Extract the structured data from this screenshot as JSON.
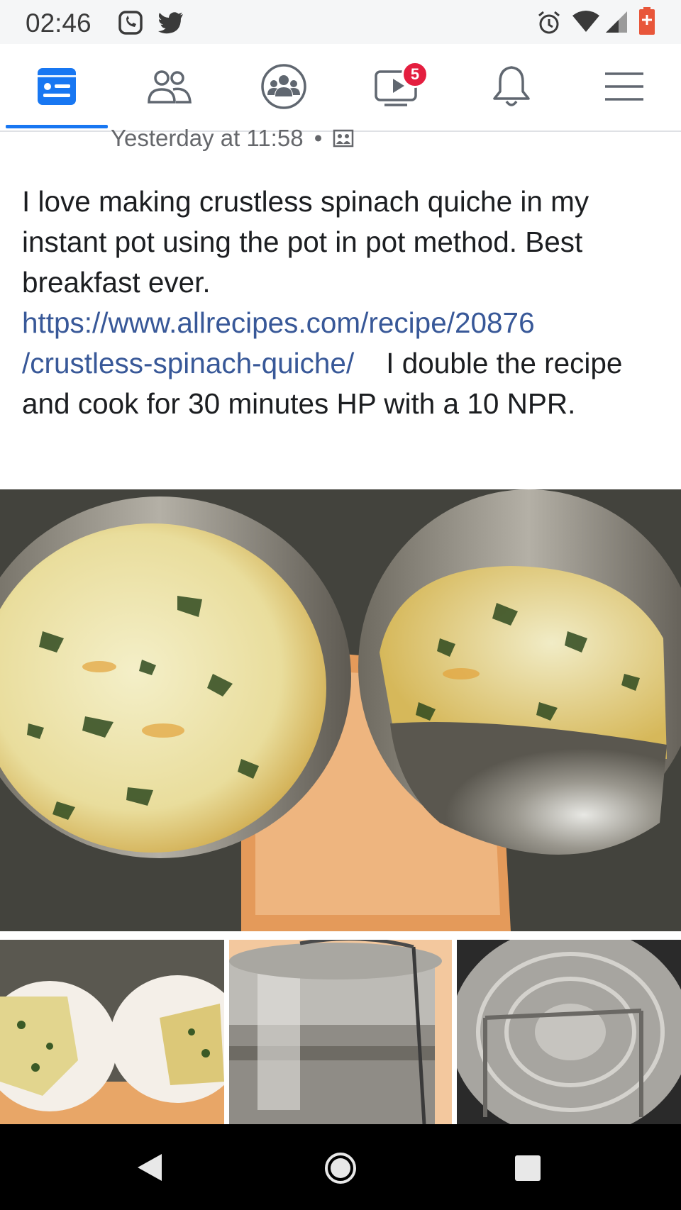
{
  "status_bar": {
    "time": "02:46",
    "left_icons": [
      "whatsapp-icon",
      "twitter-icon"
    ],
    "right_icons": [
      "alarm-icon",
      "wifi-icon",
      "signal-icon",
      "battery-icon"
    ]
  },
  "nav": {
    "tabs": [
      {
        "name": "news-feed-icon",
        "active": true
      },
      {
        "name": "friends-icon",
        "active": false
      },
      {
        "name": "groups-icon",
        "active": false
      },
      {
        "name": "watch-icon",
        "active": false,
        "badge": "5"
      },
      {
        "name": "notifications-icon",
        "active": false
      },
      {
        "name": "menu-icon",
        "active": false
      }
    ],
    "accent_color": "#1877f2"
  },
  "post": {
    "timestamp": "Yesterday at 11:58",
    "separator": "•",
    "audience_icon": "group-audience-icon",
    "text_intro": "I love making crustless spinach quiche in my instant pot using the pot in pot method. Best breakfast ever.",
    "link_line1": "https://www.allrecipes.com/recipe/20876",
    "link_line2": "/crustless-spinach-quiche/",
    "text_after_link": "I double the recipe and cook for 30 minutes HP with a 10 NPR.",
    "link_color": "#385898"
  },
  "photos": {
    "main": "quiche-in-pans-photo",
    "thumbnails": [
      "quiche-slices-photo",
      "stacked-pots-photo",
      "trivet-rack-photo"
    ]
  },
  "system_nav": {
    "buttons": [
      "back-button",
      "home-button",
      "recents-button"
    ]
  }
}
